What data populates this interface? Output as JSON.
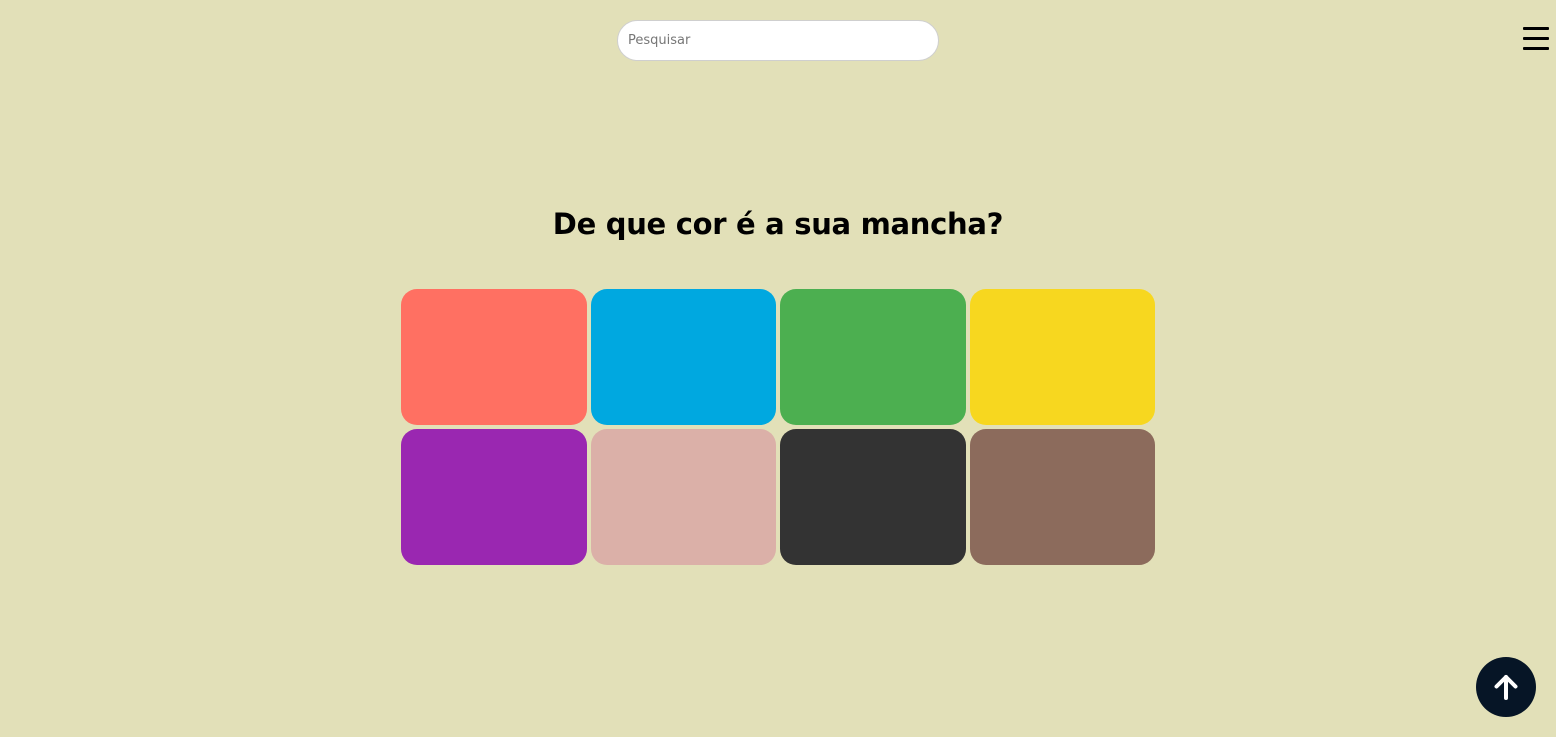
{
  "search": {
    "placeholder": "Pesquisar",
    "value": ""
  },
  "header": {
    "menu_icon": "hamburger-menu-icon"
  },
  "main": {
    "title": "De que cor é a sua mancha?"
  },
  "colors": [
    {
      "name": "vermelho",
      "hex": "#ff7062"
    },
    {
      "name": "azul",
      "hex": "#00a8e0"
    },
    {
      "name": "verde",
      "hex": "#4caf50"
    },
    {
      "name": "amarelo",
      "hex": "#f7d71f"
    },
    {
      "name": "roxo",
      "hex": "#9a27b1"
    },
    {
      "name": "rosa",
      "hex": "#dbb0a8"
    },
    {
      "name": "preto",
      "hex": "#333333"
    },
    {
      "name": "marrom",
      "hex": "#8c6b5c"
    }
  ],
  "scroll_top": {
    "icon": "arrow-up-icon",
    "background": "#061526"
  },
  "theme": {
    "background": "#e2e0b8"
  }
}
